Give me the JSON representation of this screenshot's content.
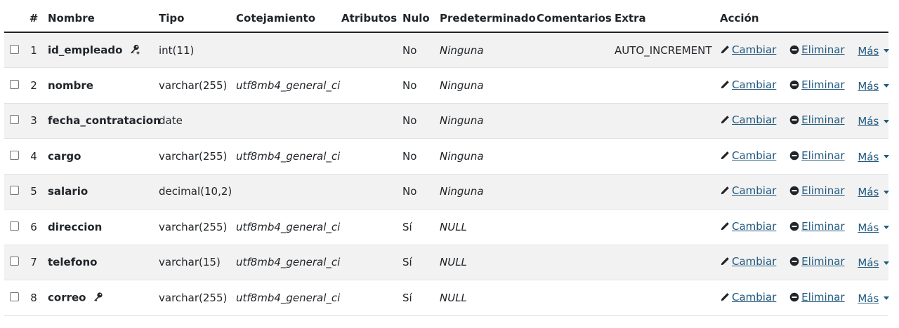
{
  "headers": {
    "num": "#",
    "name": "Nombre",
    "type": "Tipo",
    "collation": "Cotejamiento",
    "attributes": "Atributos",
    "null": "Nulo",
    "default": "Predeterminado",
    "comments": "Comentarios",
    "extra": "Extra",
    "action": "Acción"
  },
  "actions": {
    "change": "Cambiar",
    "drop": "Eliminar",
    "more": "Más"
  },
  "rows": [
    {
      "num": "1",
      "name": "id_empleado",
      "type": "int(11)",
      "collation": "",
      "attributes": "",
      "null": "No",
      "default": "Ninguna",
      "comments": "",
      "extra": "AUTO_INCREMENT",
      "icon": "primary-key-icon"
    },
    {
      "num": "2",
      "name": "nombre",
      "type": "varchar(255)",
      "collation": "utf8mb4_general_ci",
      "attributes": "",
      "null": "No",
      "default": "Ninguna",
      "comments": "",
      "extra": "",
      "icon": ""
    },
    {
      "num": "3",
      "name": "fecha_contratacion",
      "type": "date",
      "collation": "",
      "attributes": "",
      "null": "No",
      "default": "Ninguna",
      "comments": "",
      "extra": "",
      "icon": ""
    },
    {
      "num": "4",
      "name": "cargo",
      "type": "varchar(255)",
      "collation": "utf8mb4_general_ci",
      "attributes": "",
      "null": "No",
      "default": "Ninguna",
      "comments": "",
      "extra": "",
      "icon": ""
    },
    {
      "num": "5",
      "name": "salario",
      "type": "decimal(10,2)",
      "collation": "",
      "attributes": "",
      "null": "No",
      "default": "Ninguna",
      "comments": "",
      "extra": "",
      "icon": ""
    },
    {
      "num": "6",
      "name": "direccion",
      "type": "varchar(255)",
      "collation": "utf8mb4_general_ci",
      "attributes": "",
      "null": "Sí",
      "default": "NULL",
      "comments": "",
      "extra": "",
      "icon": ""
    },
    {
      "num": "7",
      "name": "telefono",
      "type": "varchar(15)",
      "collation": "utf8mb4_general_ci",
      "attributes": "",
      "null": "Sí",
      "default": "NULL",
      "comments": "",
      "extra": "",
      "icon": ""
    },
    {
      "num": "8",
      "name": "correo",
      "type": "varchar(255)",
      "collation": "utf8mb4_general_ci",
      "attributes": "",
      "null": "Sí",
      "default": "NULL",
      "comments": "",
      "extra": "",
      "icon": "unique-key-icon"
    }
  ],
  "colors": {
    "link": "#235a81",
    "stripe": "#f2f2f2",
    "border": "#dee2e6"
  }
}
